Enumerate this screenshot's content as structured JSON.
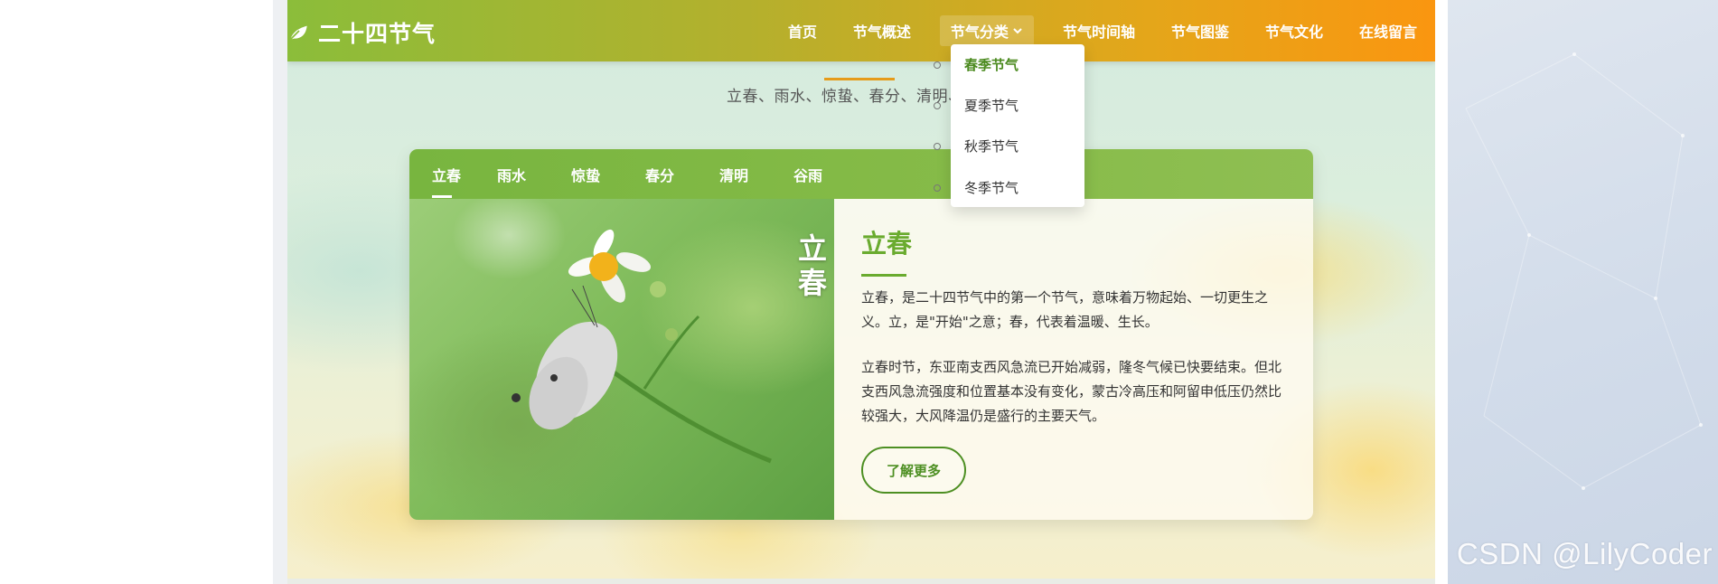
{
  "site": {
    "title": "二十四节气",
    "logo_icon": "leaf-icon"
  },
  "nav": {
    "items": [
      {
        "label": "首页"
      },
      {
        "label": "节气概述"
      },
      {
        "label": "节气分类",
        "active": true,
        "icon": "chevron-down-icon"
      },
      {
        "label": "节气时间轴"
      },
      {
        "label": "节气图鉴"
      },
      {
        "label": "节气文化"
      },
      {
        "label": "在线留言"
      }
    ]
  },
  "dropdown": {
    "items": [
      {
        "label": "春季节气",
        "active": true
      },
      {
        "label": "夏季节气"
      },
      {
        "label": "秋季节气"
      },
      {
        "label": "冬季节气"
      }
    ]
  },
  "hero": {
    "subtitle": "立春、雨水、惊蛰、春分、清明、谷雨"
  },
  "tabs": [
    {
      "label": "立春",
      "active": true
    },
    {
      "label": "雨水"
    },
    {
      "label": "惊蛰"
    },
    {
      "label": "春分"
    },
    {
      "label": "清明"
    },
    {
      "label": "谷雨"
    }
  ],
  "card": {
    "photo_title": "立春",
    "title": "立春",
    "para1": "立春，是二十四节气中的第一个节气，意味着万物起始、一切更生之义。立，是\"开始\"之意；春，代表着温暖、生长。",
    "para2": "立春时节，东亚南支西风急流已开始减弱，隆冬气候已快要结束。但北支西风急流强度和位置基本没有变化，蒙古冷高压和阿留申低压仍然比较强大，大风降温仍是盛行的主要天气。",
    "button": "了解更多"
  },
  "watermark": "CSDN @LilyCoder",
  "colors": {
    "nav_start": "#8bbd3a",
    "nav_end": "#fa9610",
    "tab_bar": "#78b53f",
    "accent_green": "#6aab2f",
    "accent_orange": "#e69b1a"
  }
}
